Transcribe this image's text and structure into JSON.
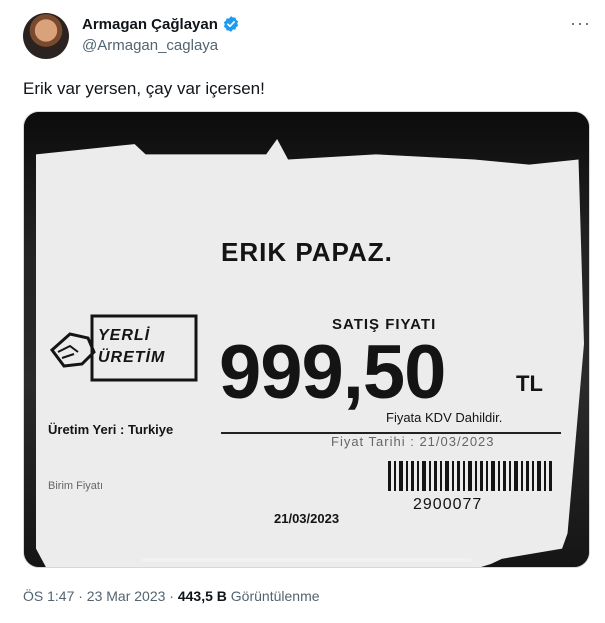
{
  "author": {
    "name": "Armagan Çağlayan",
    "handle": "@Armagan_caglaya",
    "verified_icon": "verified-badge-icon",
    "verified_color": "#1d9bf0"
  },
  "menu_icon": "more-icon",
  "tweet": {
    "text": "Erik var yersen, çay var içersen!"
  },
  "media": {
    "label_product": "ERIK PAPAZ.",
    "label_sale_title": "SATIŞ FIYATI",
    "label_price": "999,50",
    "label_currency": "TL",
    "label_vat": "Fiyata KDV Dahildir.",
    "label_price_date": "Fiyat Tarihi : 21/03/2023",
    "label_logo_line1": "YERLİ",
    "label_logo_line2": "ÜRETİM",
    "label_origin": "Üretim Yeri : Turkiye",
    "label_unit_price": "Birim Fiyatı",
    "label_date": "21/03/2023",
    "label_barcode": "2900077"
  },
  "meta": {
    "time_date": "ÖS 1:47 · 23 Mar 2023 · ",
    "views_count": "443,5 B",
    "views_label": " Görüntülenme"
  }
}
